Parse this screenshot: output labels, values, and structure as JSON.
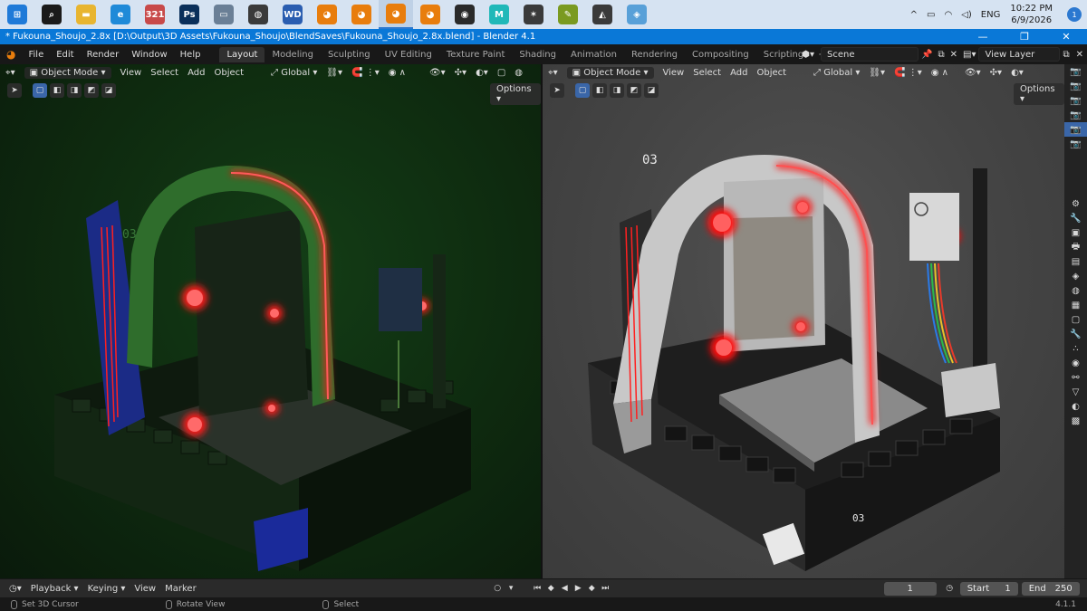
{
  "taskbar": {
    "apps": [
      {
        "name": "windows-start-icon",
        "glyph": "⊞",
        "color": "#1f7ad8"
      },
      {
        "name": "search-icon",
        "glyph": "⌕",
        "color": "#1a1a1a"
      },
      {
        "name": "file-explorer-icon",
        "glyph": "▬",
        "color": "#e8b530"
      },
      {
        "name": "edge-icon",
        "glyph": "e",
        "color": "#1f8ad8"
      },
      {
        "name": "calendar-app-icon",
        "glyph": "321",
        "color": "#c84a4a"
      },
      {
        "name": "photoshop-icon",
        "glyph": "Ps",
        "color": "#0a2f5a"
      },
      {
        "name": "screen-capture-icon",
        "glyph": "▭",
        "color": "#6a7f96"
      },
      {
        "name": "blender-launcher-icon",
        "glyph": "◍",
        "color": "#3a3a3a"
      },
      {
        "name": "word-icon",
        "glyph": "WD",
        "color": "#2a5db0"
      },
      {
        "name": "blender-icon",
        "glyph": "◕",
        "color": "#e87d0d"
      },
      {
        "name": "blender-icon",
        "glyph": "◕",
        "color": "#e87d0d"
      },
      {
        "name": "blender-active-icon",
        "glyph": "◕",
        "color": "#e87d0d"
      },
      {
        "name": "blender-icon",
        "glyph": "◕",
        "color": "#e87d0d"
      },
      {
        "name": "obs-icon",
        "glyph": "◉",
        "color": "#2a2a2a"
      },
      {
        "name": "maya-icon",
        "glyph": "M",
        "color": "#20b8b8"
      },
      {
        "name": "character-app-icon",
        "glyph": "✶",
        "color": "#3a3a3a"
      },
      {
        "name": "script-app-icon",
        "glyph": "✎",
        "color": "#7a9a20"
      },
      {
        "name": "fox-app-icon",
        "glyph": "◭",
        "color": "#3a3a3a"
      },
      {
        "name": "tablet-app-icon",
        "glyph": "◈",
        "color": "#58a0d8"
      }
    ],
    "tray": {
      "language": "ENG",
      "time": "10:22 PM",
      "date": "6/9/2026",
      "notifications": "1"
    }
  },
  "window": {
    "title": "* Fukouna_Shoujo_2.8x [D:\\Output\\3D Assets\\Fukouna_Shoujo\\BlendSaves\\Fukouna_Shoujo_2.8x.blend] - Blender 4.1",
    "controls": [
      "—",
      "❐",
      "✕"
    ]
  },
  "menu": [
    "File",
    "Edit",
    "Render",
    "Window",
    "Help"
  ],
  "workspaces": {
    "tabs": [
      "Layout",
      "Modeling",
      "Sculpting",
      "UV Editing",
      "Texture Paint",
      "Shading",
      "Animation",
      "Rendering",
      "Compositing",
      "Scripting"
    ],
    "active": 0,
    "add": "+"
  },
  "scene": {
    "label": "Scene",
    "view_layer": "View Layer"
  },
  "viewport_header": {
    "mode": "Object Mode",
    "menus": [
      "View",
      "Select",
      "Add",
      "Object"
    ],
    "orientation": "Global",
    "options": "Options"
  },
  "timeline": {
    "menus": [
      "Playback",
      "Keying",
      "View",
      "Marker"
    ],
    "current_frame": "1",
    "start_label": "Start",
    "start": "1",
    "end_label": "End",
    "end": "250"
  },
  "status": {
    "left_action": "Set 3D Cursor",
    "middle_action": "Rotate View",
    "right_action": "Select",
    "version": "4.1.1"
  },
  "properties_icons": [
    "camera-icon",
    "camera-icon",
    "camera-icon",
    "camera-icon",
    "camera-icon",
    "camera-icon",
    "tool-icon",
    "wrench-settings-icon",
    "render-icon",
    "output-icon",
    "view-layer-icon",
    "scene-icon",
    "world-icon",
    "collection-icon",
    "object-icon",
    "modifier-icon",
    "particles-icon",
    "physics-icon",
    "constraints-icon",
    "data-icon",
    "material-icon",
    "texture-icon"
  ],
  "colors": {
    "accent": "#3a66a8",
    "neon_red": "#ff1a1a",
    "title_blue": "#0a78d7"
  },
  "model_labels": {
    "left_panel": "03",
    "right_panel": "03",
    "base_plate": "03"
  }
}
